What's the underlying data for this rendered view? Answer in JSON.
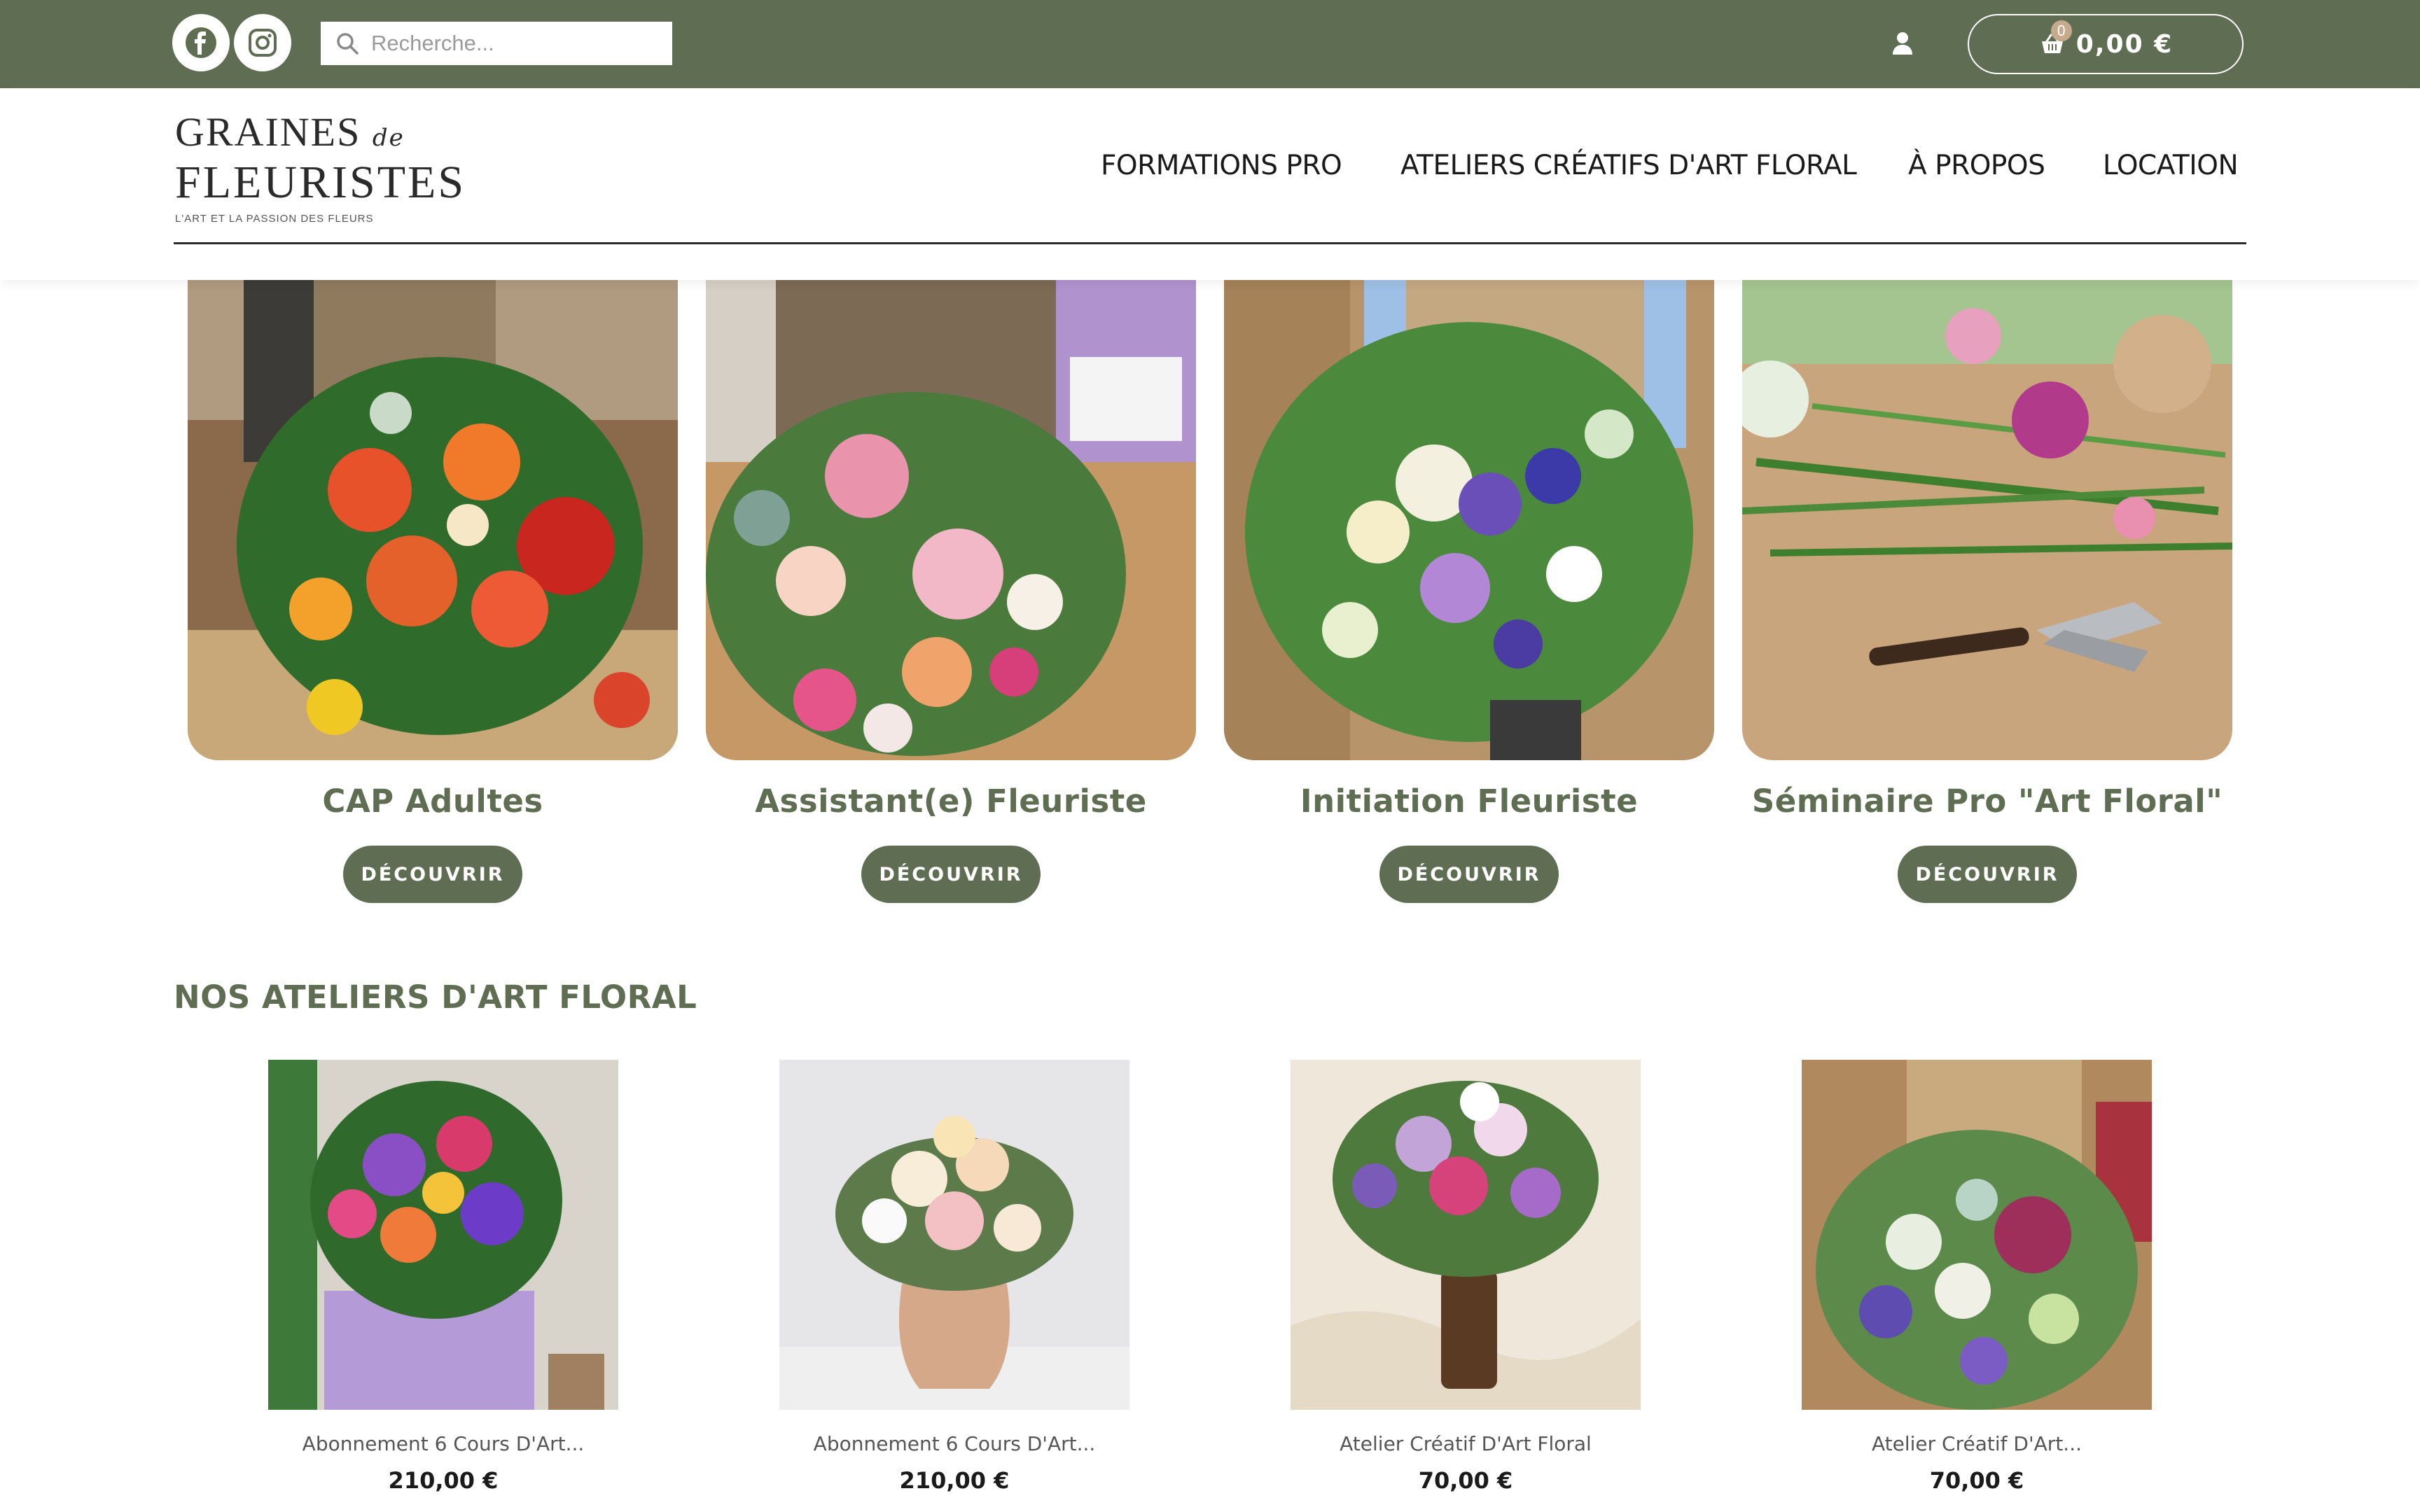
{
  "topbar": {
    "search_placeholder": "Recherche...",
    "cart_count": "0",
    "cart_total": "0,00 €",
    "icons": [
      "facebook-icon",
      "instagram-icon",
      "search-icon",
      "user-icon",
      "basket-icon"
    ]
  },
  "brand": {
    "line1": "GRAINES",
    "line1_small": "de",
    "line2": "FLEURISTES",
    "tagline": "L'ART ET LA PASSION DES FLEURS"
  },
  "nav": {
    "items": [
      {
        "label": "FORMATIONS PRO"
      },
      {
        "label": "ATELIERS CRÉATIFS D'ART FLORAL"
      },
      {
        "label": "À PROPOS"
      },
      {
        "label": "LOCATION"
      }
    ]
  },
  "formations": [
    {
      "title": "CAP Adultes",
      "cta": "DÉCOUVRIR"
    },
    {
      "title": "Assistant(e) Fleuriste",
      "cta": "DÉCOUVRIR"
    },
    {
      "title": "Initiation Fleuriste",
      "cta": "DÉCOUVRIR"
    },
    {
      "title": "Séminaire Pro \"Art Floral\"",
      "cta": "DÉCOUVRIR"
    }
  ],
  "ateliers": {
    "heading": "NOS ATELIERS D'ART FLORAL",
    "products": [
      {
        "name": "Abonnement 6 Cours D'Art...",
        "price": "210,00 €"
      },
      {
        "name": "Abonnement 6 Cours D'Art...",
        "price": "210,00 €"
      },
      {
        "name": "Atelier Créatif D'Art Floral",
        "price": "70,00 €"
      },
      {
        "name": "Atelier Créatif D'Art...",
        "price": "70,00 €"
      }
    ]
  },
  "colors": {
    "brand_green": "#5f6e52",
    "badge": "#c7a98b"
  }
}
